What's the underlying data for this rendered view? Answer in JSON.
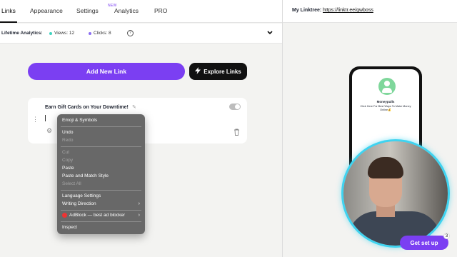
{
  "nav": {
    "tabs": [
      {
        "label": "Links"
      },
      {
        "label": "Appearance"
      },
      {
        "label": "Settings"
      },
      {
        "label": "Analytics",
        "badge": "NEW"
      },
      {
        "label": "PRO"
      }
    ]
  },
  "analytics_bar": {
    "label": "Lifetime Analytics:",
    "views": "Views: 12",
    "clicks": "Clicks: 8",
    "help": "?",
    "views_color": "#3fd3c0",
    "clicks_color": "#8a6df2"
  },
  "actions": {
    "add_link": "Add New Link",
    "explore": "Explore Links"
  },
  "link_card": {
    "title": "Earn Gift Cards on Your Downtime!"
  },
  "context_menu": {
    "items": [
      {
        "label": "Emoji & Symbols"
      },
      {
        "label": "Undo"
      },
      {
        "label": "Redo",
        "disabled": true
      },
      {
        "label": "Cut",
        "disabled": true
      },
      {
        "label": "Copy",
        "disabled": true
      },
      {
        "label": "Paste"
      },
      {
        "label": "Paste and Match Style"
      },
      {
        "label": "Select All",
        "disabled": true
      },
      {
        "label": "Language Settings"
      },
      {
        "label": "Writing Direction",
        "submenu": true
      },
      {
        "label": "AdBlock — best ad blocker",
        "submenu": true
      },
      {
        "label": "Inspect"
      }
    ]
  },
  "linktree": {
    "label": "My Linktree:",
    "url": "https://linktr.ee/gwboss"
  },
  "preview": {
    "name": "Moneypulls",
    "bio": "Click Here For Best Ways To Make Money Online💰"
  },
  "setup": {
    "label": "Get set up",
    "count": "3"
  },
  "colors": {
    "accent": "#7b3ff2",
    "dark_button": "#111111",
    "webcam_ring": "#3fd3f0"
  }
}
